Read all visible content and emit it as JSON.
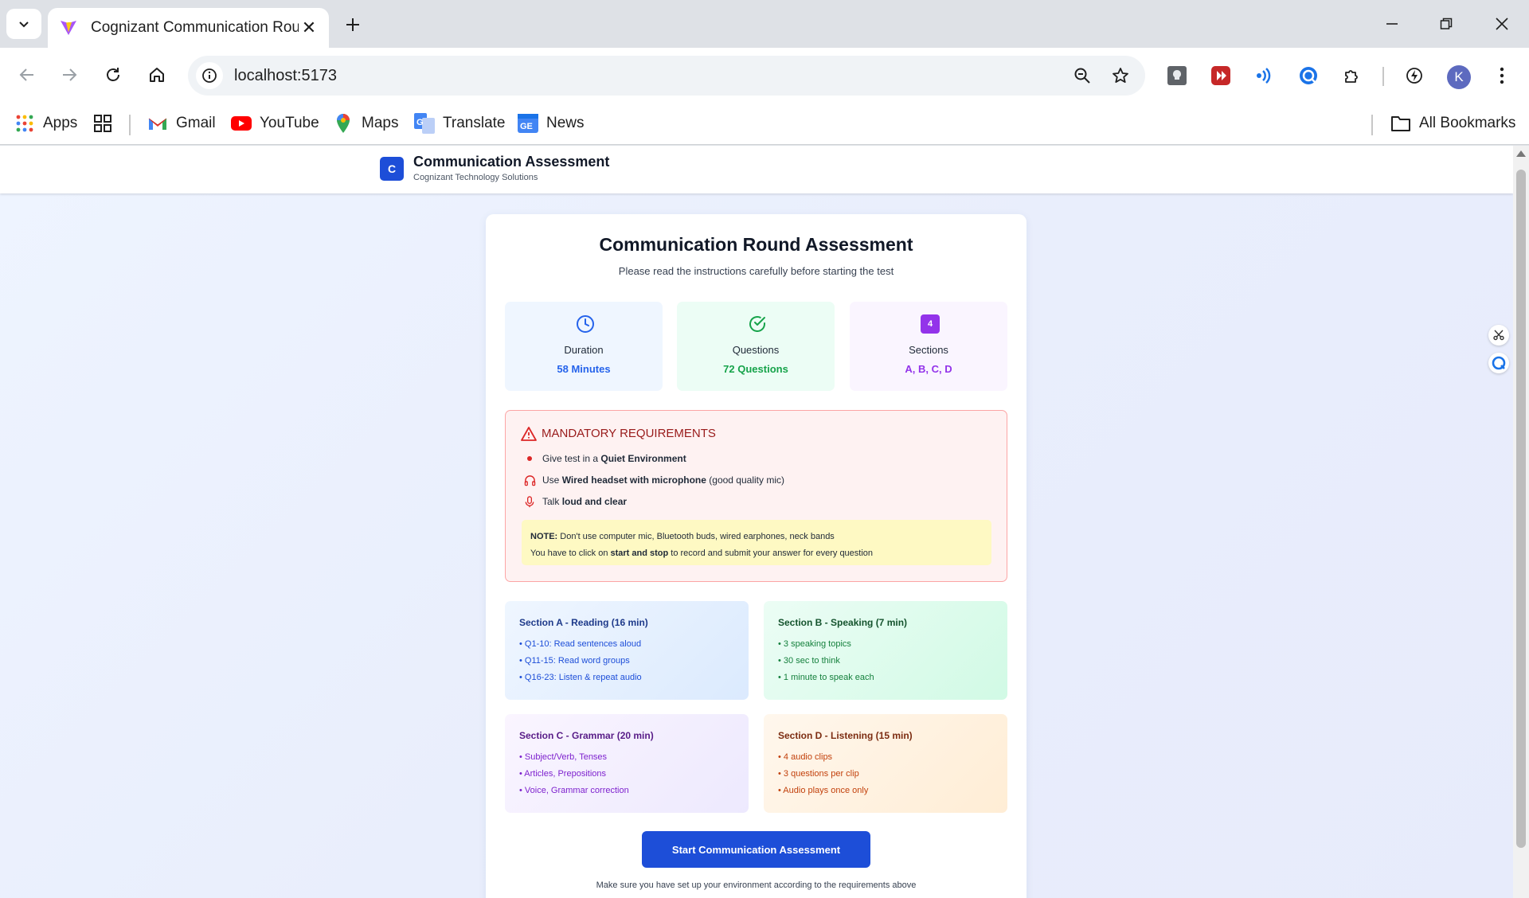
{
  "browser": {
    "tab_title": "Cognizant Communication Round",
    "url": "localhost:5173",
    "avatar_letter": "K",
    "bookmarks": [
      {
        "label": "Apps",
        "icon": "apps-grid-icon"
      },
      {
        "label": "Gmail",
        "icon": "gmail-icon"
      },
      {
        "label": "YouTube",
        "icon": "youtube-icon"
      },
      {
        "label": "Maps",
        "icon": "maps-icon"
      },
      {
        "label": "Translate",
        "icon": "translate-icon"
      },
      {
        "label": "News",
        "icon": "news-icon"
      }
    ],
    "all_bookmarks": "All Bookmarks"
  },
  "app": {
    "logo_letter": "C",
    "title": "Communication Assessment",
    "subtitle": "Cognizant Technology Solutions"
  },
  "page": {
    "title": "Communication Round Assessment",
    "lead": "Please read the instructions carefully before starting the test",
    "stats": [
      {
        "label": "Duration",
        "value": "58 Minutes",
        "color": "#2563eb",
        "bg": "#eff6ff",
        "icon": "clock-icon"
      },
      {
        "label": "Questions",
        "value": "72 Questions",
        "color": "#16a34a",
        "bg": "#ecfdf5",
        "icon": "check-circle-icon"
      },
      {
        "label": "Sections",
        "value": "A, B, C, D",
        "color": "#9333ea",
        "bg": "#faf5ff",
        "icon": "sections-badge-icon",
        "badge": "4"
      }
    ],
    "requirements": {
      "title": "MANDATORY REQUIREMENTS",
      "items": [
        {
          "pre": "Give test in a ",
          "bold": "Quiet Environment",
          "post": ""
        },
        {
          "pre": "Use ",
          "bold": "Wired headset with microphone",
          "post": " (good quality mic)"
        },
        {
          "pre": "Talk ",
          "bold": "loud and clear",
          "post": ""
        }
      ],
      "note_label": "NOTE:",
      "note_line1": " Don't use computer mic, Bluetooth buds, wired earphones, neck bands",
      "note_line2_pre": "You have to click on ",
      "note_line2_bold": "start and stop",
      "note_line2_post": " to record and submit your answer for every question"
    },
    "sections": [
      {
        "title": "Section A - Reading (16 min)",
        "items": [
          "• Q1-10: Read sentences aloud",
          "• Q11-15: Read word groups",
          "• Q16-23: Listen & repeat audio"
        ]
      },
      {
        "title": "Section B - Speaking (7 min)",
        "items": [
          "• 3 speaking topics",
          "• 30 sec to think",
          "• 1 minute to speak each"
        ]
      },
      {
        "title": "Section C - Grammar (20 min)",
        "items": [
          "• Subject/Verb, Tenses",
          "• Articles, Prepositions",
          "• Voice, Grammar correction"
        ]
      },
      {
        "title": "Section D - Listening (15 min)",
        "items": [
          "• 4 audio clips",
          "• 3 questions per clip",
          "• Audio plays once only"
        ]
      }
    ],
    "start_button": "Start Communication Assessment",
    "footer": "Make sure you have set up your environment according to the requirements above"
  }
}
